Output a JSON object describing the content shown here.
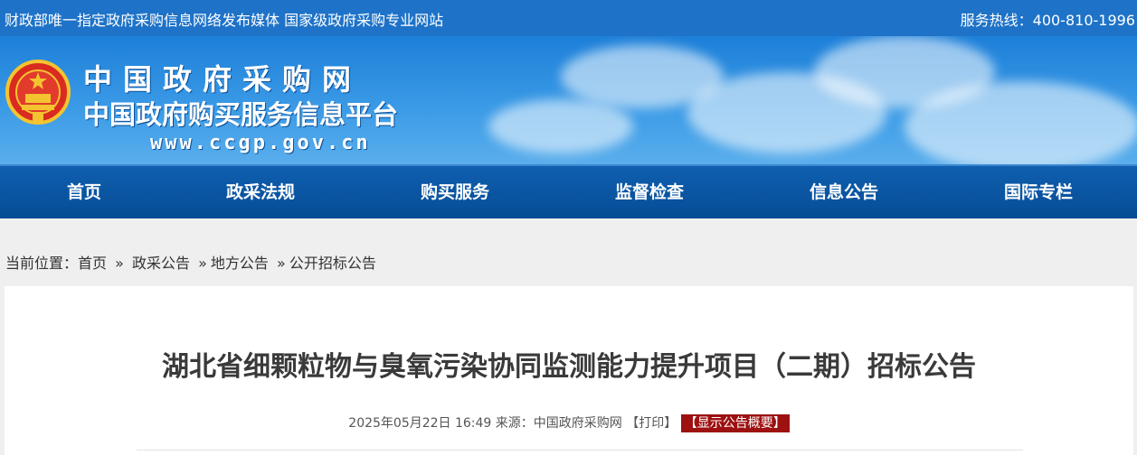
{
  "topbar": {
    "slogan": "财政部唯一指定政府采购信息网络发布媒体 国家级政府采购专业网站",
    "hotline": "服务热线：400-810-1996"
  },
  "banner": {
    "title": "中国政府采购网",
    "subtitle": "中国政府购买服务信息平台",
    "url": "www.ccgp.gov.cn",
    "emblem_icon": "national-emblem"
  },
  "nav": {
    "items": [
      {
        "label": "首页"
      },
      {
        "label": "政采法规"
      },
      {
        "label": "购买服务"
      },
      {
        "label": "监督检查"
      },
      {
        "label": "信息公告"
      },
      {
        "label": "国际专栏"
      }
    ]
  },
  "breadcrumb": {
    "prefix": "当前位置：",
    "items": [
      "首页",
      "政采公告",
      "地方公告",
      "公开招标公告"
    ],
    "separator": "»"
  },
  "article": {
    "title": "湖北省细颗粒物与臭氧污染协同监测能力提升项目（二期）招标公告",
    "date": "2025年05月22日 16:49",
    "source_label": "来源：",
    "source": "中国政府采购网",
    "print_label": "【打印】",
    "summary_label": "【显示公告概要】"
  },
  "colors": {
    "topbar": "#1e73c8",
    "nav": "#064c95",
    "summary_button": "#9e1111"
  }
}
